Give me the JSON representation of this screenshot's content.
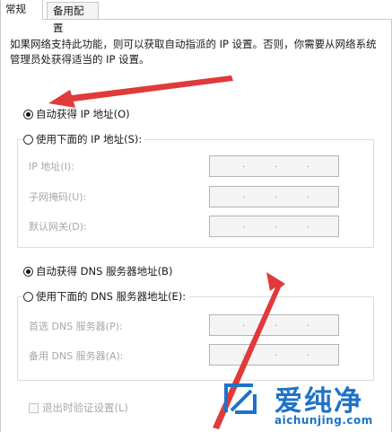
{
  "tabs": [
    {
      "label": "常规"
    },
    {
      "label": "备用配置"
    }
  ],
  "description": "如果网络支持此功能，则可以获取自动指派的 IP 设置。否则，你需要从网络系统管理员处获得适当的 IP 设置。",
  "ip_section": {
    "auto_option": "自动获得 IP 地址(O)",
    "manual_option": "使用下面的 IP 地址(S):",
    "fields": [
      {
        "label": "IP 地址(I):",
        "value": ". . ."
      },
      {
        "label": "子网掩码(U):",
        "value": ". . ."
      },
      {
        "label": "默认网关(D):",
        "value": ". . ."
      }
    ]
  },
  "dns_section": {
    "auto_option": "自动获得 DNS 服务器地址(B)",
    "manual_option": "使用下面的 DNS 服务器地址(E):",
    "fields": [
      {
        "label": "首选 DNS 服务器(P):",
        "value": ". . ."
      },
      {
        "label": "备用 DNS 服务器(A):",
        "value": ". . ."
      }
    ]
  },
  "validate_checkbox": "退出时验证设置(L)",
  "watermark": {
    "brand_cn": "爱纯净",
    "brand_en": "aichunjing.com"
  },
  "colors": {
    "arrow": "#e03a3a",
    "watermark": "#1e73c8",
    "disabled_text": "#a8a8a8"
  }
}
